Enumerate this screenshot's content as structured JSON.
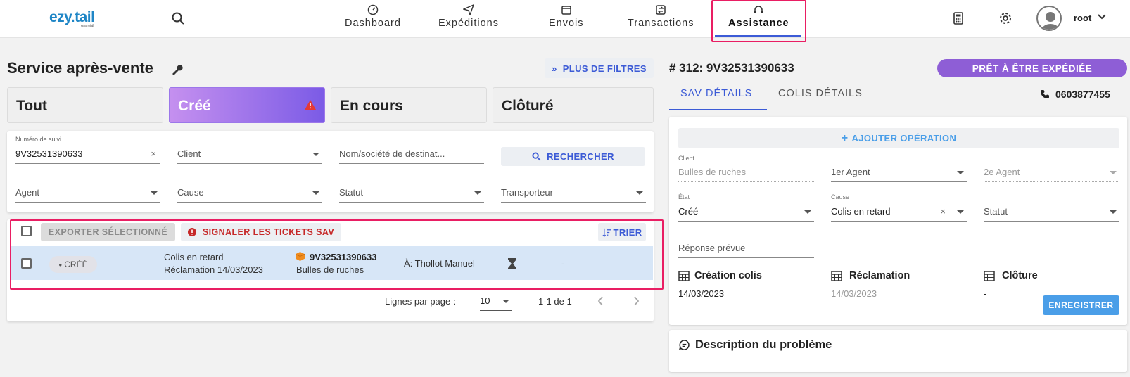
{
  "brand": {
    "logo": "ezy.tail",
    "sub": "easy retail"
  },
  "nav": {
    "items": [
      {
        "label": "Dashboard",
        "icon": "dashboard-gauge-icon"
      },
      {
        "label": "Expéditions",
        "icon": "send-icon"
      },
      {
        "label": "Envois",
        "icon": "box-icon"
      },
      {
        "label": "Transactions",
        "icon": "exchange-icon"
      },
      {
        "label": "Assistance",
        "icon": "headset-icon"
      }
    ],
    "active": "Assistance",
    "user": "root"
  },
  "left": {
    "title": "Service après-vente",
    "more_filters": "PLUS DE FILTRES",
    "tabs": [
      "Tout",
      "Créé",
      "En cours",
      "Clôturé"
    ],
    "active_tab": "Créé",
    "filters": {
      "tracking_label": "Numéro de suivi",
      "tracking_value": "9V32531390633",
      "client": "Client",
      "recipient_placeholder": "Nom/société de destinat...",
      "search": "RECHERCHER",
      "agent": "Agent",
      "cause": "Cause",
      "status": "Statut",
      "carrier": "Transporteur"
    },
    "actions": {
      "export": "EXPORTER SÉLECTIONNÉ",
      "report": "SIGNALER LES TICKETS SAV",
      "sort": "TRIER"
    },
    "rows": [
      {
        "status": "CRÉÉ",
        "cause": "Colis en retard",
        "claim": "Réclamation 14/03/2023",
        "tracking": "9V32531390633",
        "client": "Bulles de ruches",
        "recipient": "À: Thollot Manuel",
        "extra": "-"
      }
    ],
    "pagination": {
      "rows_label": "Lignes par page :",
      "rows_value": "10",
      "range": "1-1 de 1"
    }
  },
  "right": {
    "title": "# 312: 9V32531390633",
    "status": "PRÊT À ÊTRE EXPÉDIÉE",
    "tabs": [
      "SAV DÉTAILS",
      "COLIS DÉTAILS"
    ],
    "phone": "0603877455",
    "add_operation": "AJOUTER OPÉRATION",
    "fields": {
      "client_label": "Client",
      "client_value": "Bulles de ruches",
      "agent1": "1er Agent",
      "agent2": "2e Agent",
      "state_label": "État",
      "state_value": "Créé",
      "cause_label": "Cause",
      "cause_value": "Colis en retard",
      "status": "Statut",
      "expected": "Réponse prévue"
    },
    "dates": {
      "creation_title": "Création colis",
      "creation_value": "14/03/2023",
      "claim_title": "Réclamation",
      "claim_value": "14/03/2023",
      "closure_title": "Clôture",
      "closure_value": "-"
    },
    "save": "ENREGISTRER",
    "description_title": "Description du problème"
  },
  "colors": {
    "accent": "#3c5bd6",
    "highlight": "#e91e63",
    "status_purple": "#8e5ed6",
    "error_red": "#c62828"
  }
}
